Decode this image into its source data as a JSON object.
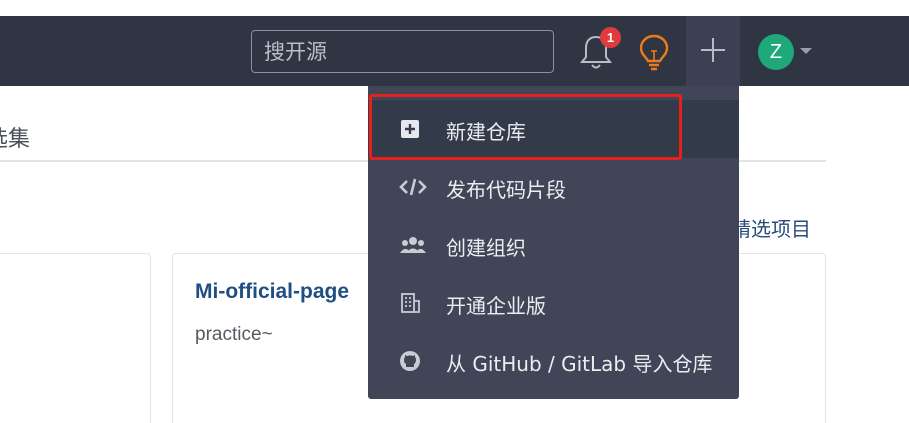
{
  "header": {
    "search_placeholder": "搜开源",
    "notification_count": "1",
    "avatar_letter": "Z"
  },
  "main": {
    "tab_partial": "选集",
    "featured_link": "精选项目",
    "card": {
      "title": "Mi-official-page",
      "description": "practice~"
    }
  },
  "dropdown": {
    "items": [
      {
        "label": "新建仓库",
        "icon": "plus-square-icon",
        "highlighted": true
      },
      {
        "label": "发布代码片段",
        "icon": "code-icon"
      },
      {
        "label": "创建组织",
        "icon": "users-icon"
      },
      {
        "label": "开通企业版",
        "icon": "building-icon"
      },
      {
        "label": "从 GitHub / GitLab 导入仓库",
        "icon": "github-icon"
      }
    ]
  },
  "colors": {
    "header_bg": "#2f3542",
    "dropdown_bg": "#404657",
    "highlight_border": "#e8201c",
    "badge": "#e03a3e",
    "avatar": "#1fa87a",
    "bulb": "#f07a19"
  }
}
